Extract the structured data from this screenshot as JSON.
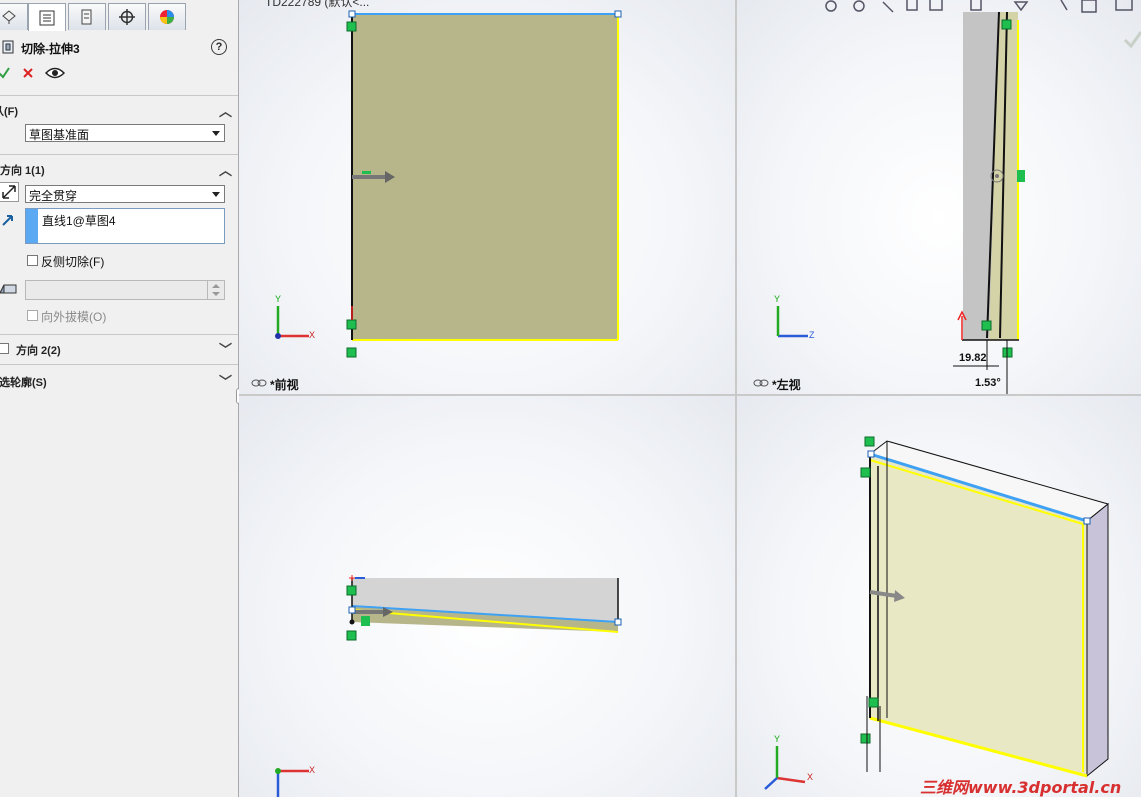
{
  "panel": {
    "tabs": [
      "featuremanager-tab",
      "propertymanager-tab",
      "configurationmanager-tab",
      "dimxpert-tab",
      "display-manager-tab"
    ],
    "title": "切除-拉伸3",
    "help": "?",
    "from_section": {
      "label": "从(F)",
      "value": "草图基准面"
    },
    "direction1": {
      "label": "方向 1(1)",
      "end_condition": "完全贯穿",
      "selection": "直线1@草图4",
      "flip_side_cut": "反侧切除(F)",
      "draft_outward": "向外拔模(O)"
    },
    "direction2": {
      "label": "方向 2(2)"
    },
    "selected_contours": {
      "label": "所选轮廓(S)"
    }
  },
  "viewport": {
    "top_text": "TD222789 (默认<...",
    "views": {
      "front": "*前视",
      "left": "*左视",
      "top": "",
      "iso": ""
    },
    "dims": {
      "d1": "19.82",
      "d2": "1.53°"
    },
    "axes": {
      "x": "X",
      "y": "Y",
      "z": "Z"
    },
    "watermark": "三维网www.3dportal.cn"
  },
  "colors": {
    "face_front": "#b7b68b",
    "face_iso": "#e9e8c4",
    "edge_highlight": "#ffff00",
    "selection_blue": "#3fa1f4",
    "handle_green": "#1fbf4f"
  }
}
